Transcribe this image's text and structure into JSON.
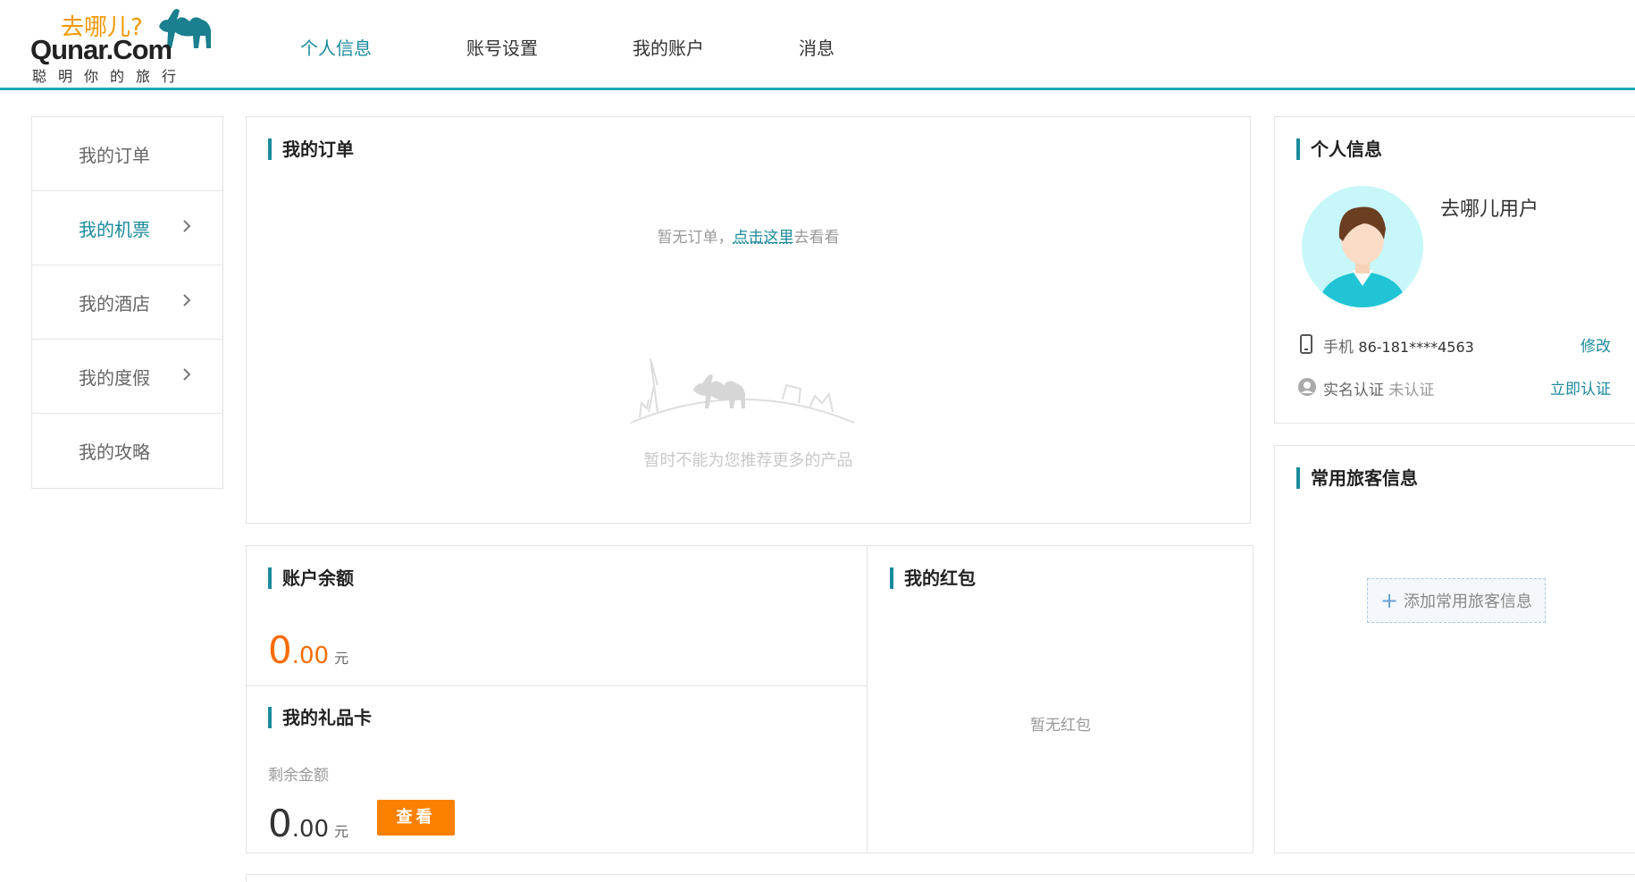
{
  "brand": {
    "cn": "去哪儿?",
    "en": "Qunar.Com",
    "slogan": "聪明你的旅行"
  },
  "nav": [
    {
      "label": "个人信息",
      "active": true
    },
    {
      "label": "账号设置",
      "active": false
    },
    {
      "label": "我的账户",
      "active": false
    },
    {
      "label": "消息",
      "active": false
    }
  ],
  "sidebar": [
    {
      "label": "我的订单",
      "active": false,
      "arrow": false
    },
    {
      "label": "我的机票",
      "active": true,
      "arrow": true
    },
    {
      "label": "我的酒店",
      "active": false,
      "arrow": true
    },
    {
      "label": "我的度假",
      "active": false,
      "arrow": true
    },
    {
      "label": "我的攻略",
      "active": false,
      "arrow": false
    }
  ],
  "orders": {
    "title": "我的订单",
    "empty_prefix": "暂无订单，",
    "empty_link": "点击这里",
    "empty_suffix": "去看看",
    "no_recommend": "暂时不能为您推荐更多的产品"
  },
  "balance": {
    "title": "账户余额",
    "int": "0",
    "dec": ".00",
    "unit": "元"
  },
  "giftcard": {
    "title": "我的礼品卡",
    "remain_label": "剩余金额",
    "int": "0",
    "dec": ".00",
    "unit": "元",
    "view_label": "查看"
  },
  "redpacket": {
    "title": "我的红包",
    "empty": "暂无红包"
  },
  "profile": {
    "title": "个人信息",
    "username": "去哪儿用户",
    "phone_label": "手机",
    "phone": "86-181****4563",
    "edit_label": "修改",
    "realname_label": "实名认证",
    "realname_status": "未认证",
    "verify_label": "立即认证"
  },
  "travelers": {
    "title": "常用旅客信息",
    "add_label": "添加常用旅客信息"
  },
  "colors": {
    "accent": "#1a8b9c",
    "header_line": "#1ba9ba",
    "orange": "#f56d05",
    "button": "#fb8000"
  }
}
